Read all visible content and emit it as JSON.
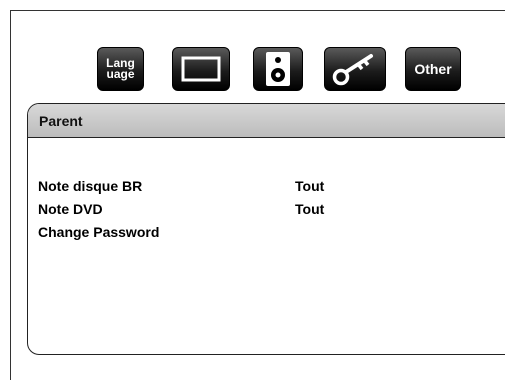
{
  "toolbar": {
    "language_label_line1": "Lang",
    "language_label_line2": "uage",
    "other_label": "Other"
  },
  "panel": {
    "title": "Parent",
    "rows": [
      {
        "label": "Note disque BR",
        "value": "Tout"
      },
      {
        "label": "Note DVD",
        "value": "Tout"
      },
      {
        "label": "Change Password",
        "value": ""
      }
    ]
  }
}
